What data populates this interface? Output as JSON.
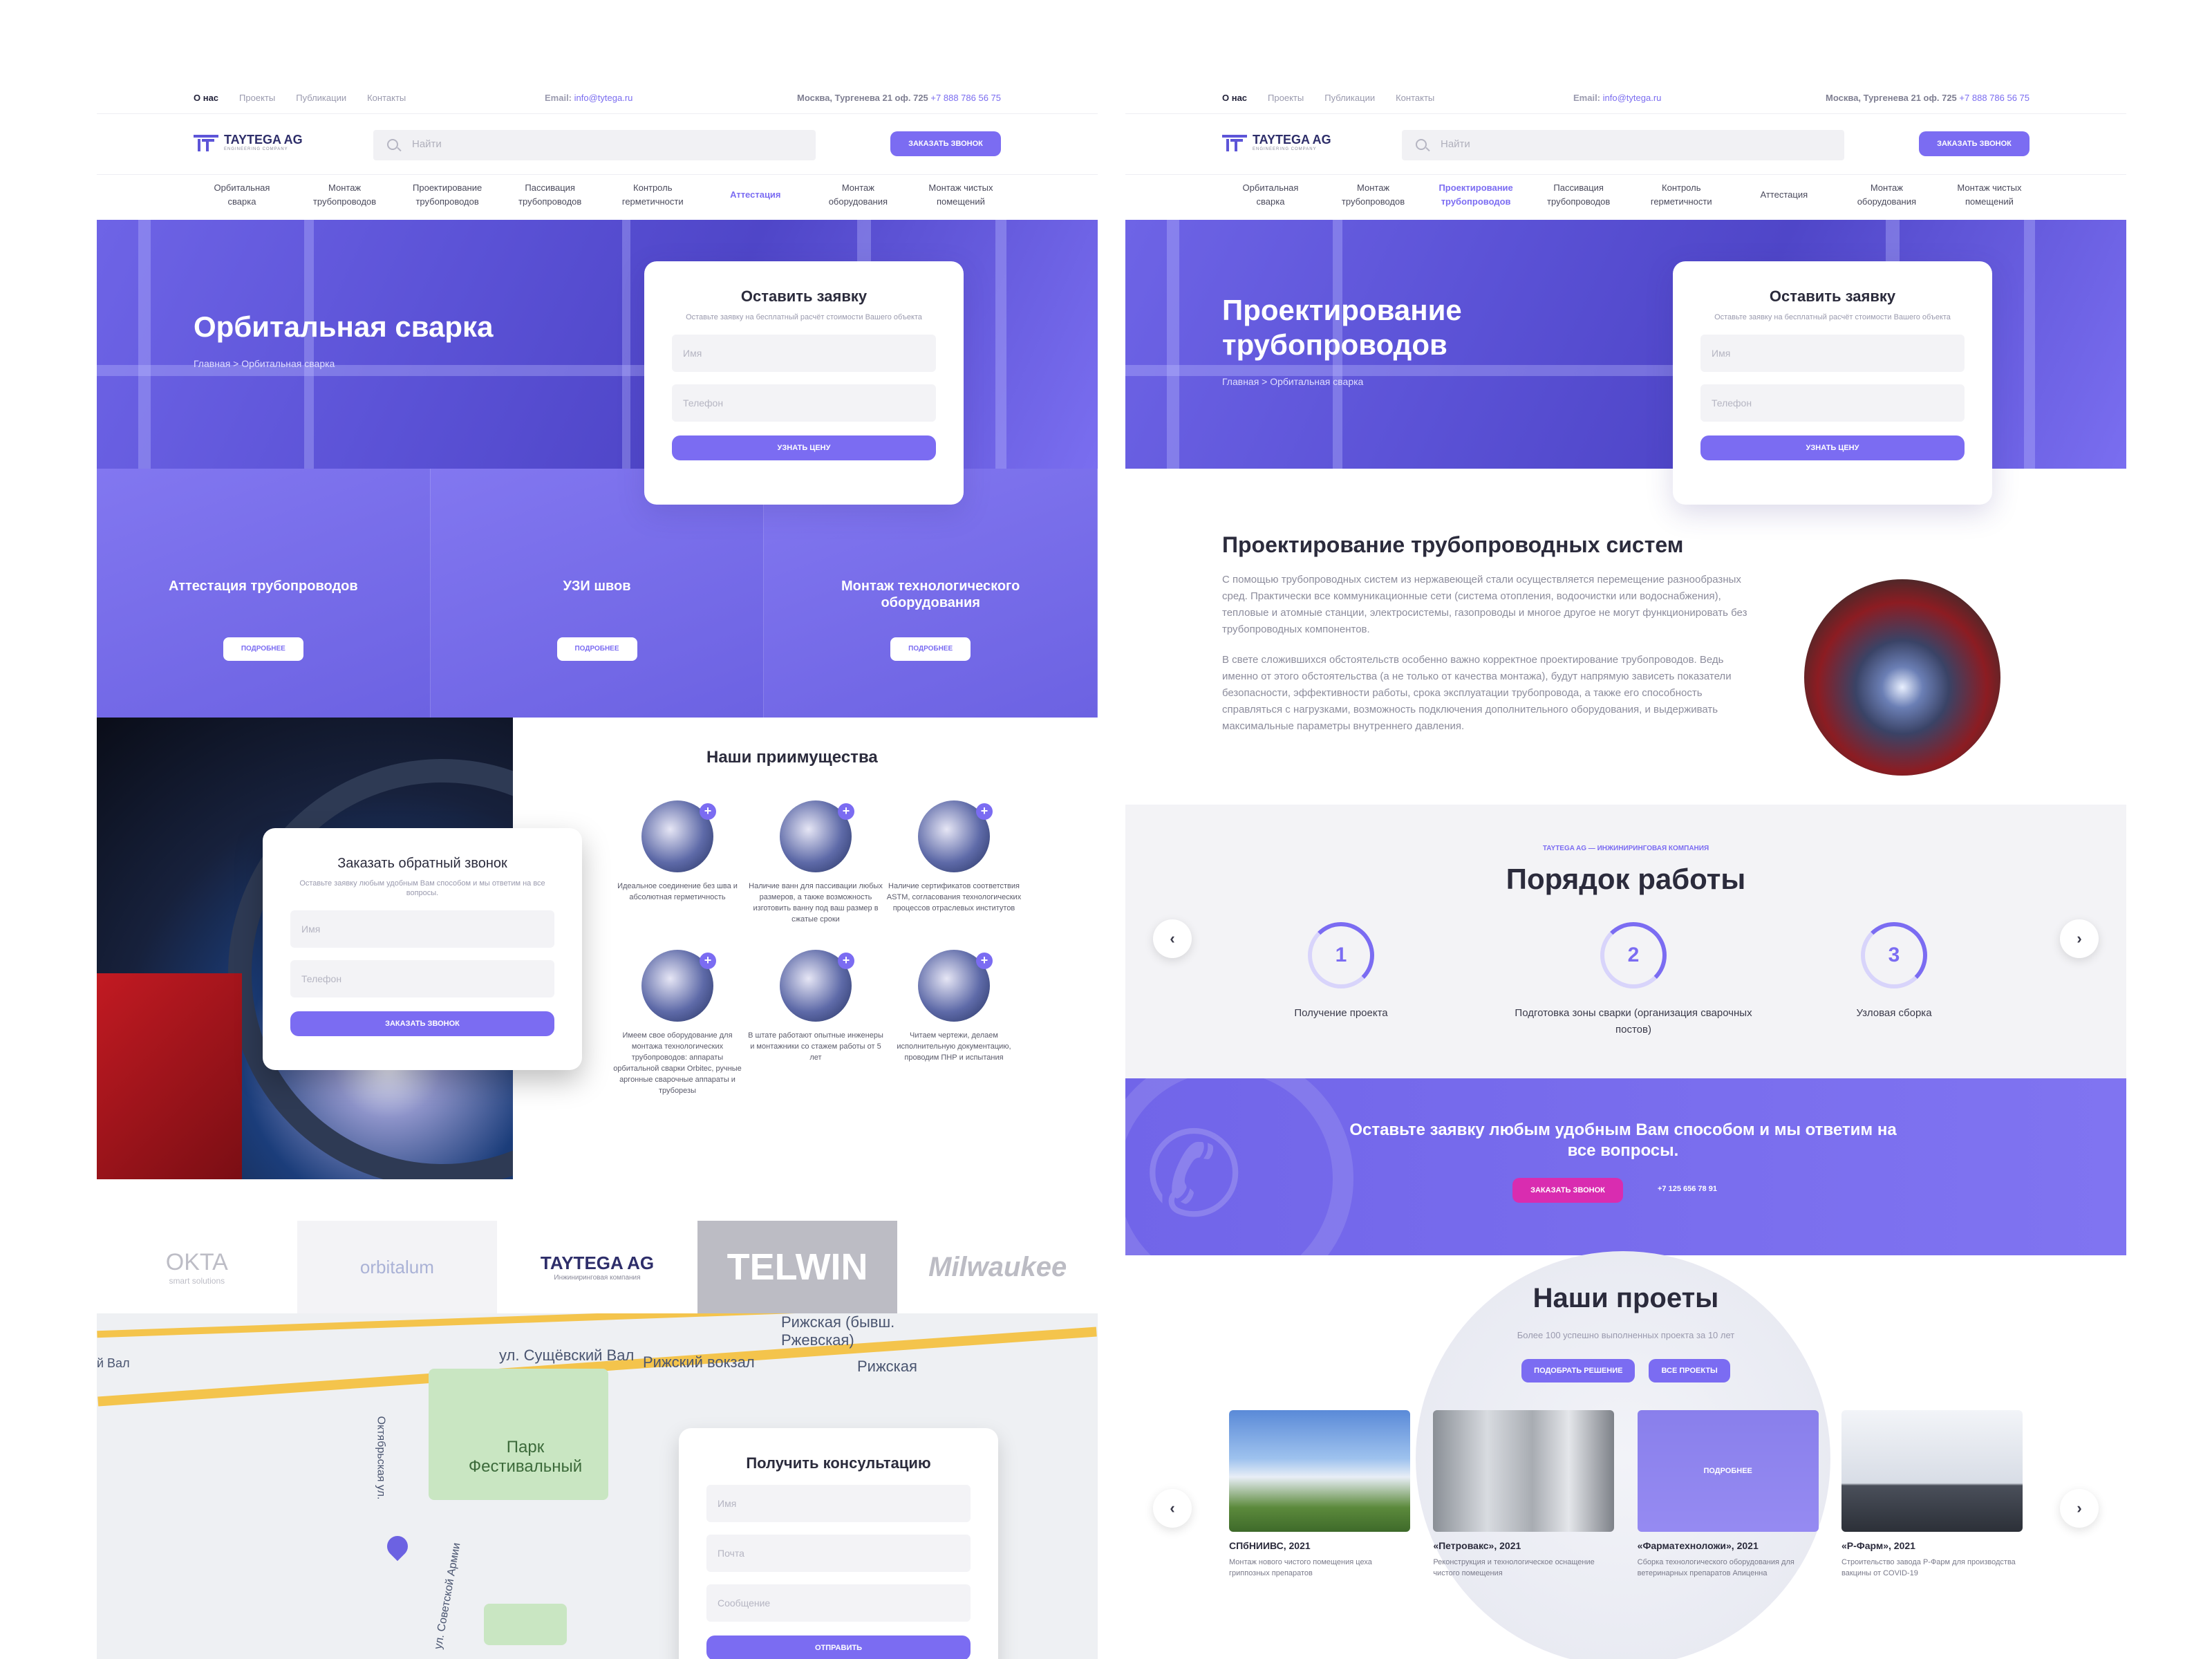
{
  "topnav": {
    "links": [
      "О нас",
      "Проекты",
      "Публикации",
      "Контакты"
    ],
    "email_label": "Email:",
    "email": "info@tytega.ru",
    "address": "Москва, Тургенева 21 оф. 725",
    "phone": "+7 888 786 56 75"
  },
  "header": {
    "logo": "TAYTEGA AG",
    "logo_sub": "ENGINEERING COMPANY",
    "search_placeholder": "Найти",
    "call_button": "ЗАКАЗАТЬ ЗВОНОК"
  },
  "catnav": [
    "Орбитальная сварка",
    "Монтаж трубопроводов",
    "Проектирование трубопроводов",
    "Пассивация трубопроводов",
    "Контроль герметичности",
    "Аттестация",
    "Монтаж оборудования",
    "Монтаж чистых помещений"
  ],
  "left": {
    "hero_title": "Орбитальная сварка",
    "breadcrumb": "Главная > Орбитальная сварка",
    "form": {
      "title": "Оставить заявку",
      "desc": "Оставьте заявку на бесплатный расчёт стоимости Вашего объекта",
      "name": "Имя",
      "phone": "Телефон",
      "button": "УЗНАТЬ ЦЕНУ"
    },
    "tiles": [
      {
        "title": "Аттестация трубопроводов",
        "button": "ПОДРОБНЕЕ"
      },
      {
        "title": "УЗИ швов",
        "button": "ПОДРОБНЕЕ"
      },
      {
        "title": "Монтаж технологического оборудования",
        "button": "ПОДРОБНЕЕ"
      }
    ],
    "callback": {
      "title": "Заказать обратный звонок",
      "desc": "Оставьте заявку любым удобным Вам способом и мы ответим на все вопросы.",
      "name": "Имя",
      "phone": "Телефон",
      "button": "ЗАКАЗАТЬ ЗВОНОК"
    },
    "adv_title": "Наши приимущества",
    "advantages": [
      "Идеальное соединение без шва и абсолютная герметичность",
      "Наличие ванн для пассивации любых размеров, а также возможность изготовить ванну под ваш размер в сжатые сроки",
      "Наличие сертификатов соответствия ASTM, согласования технологических процессов отраслевых институтов",
      "Имеем свое оборудование для монтажа технологических трубопроводов: аппараты орбитальной сварки Orbitec, ручные аргонные сварочные аппараты и труборезы",
      "В штате работают опытные инженеры и монтажники со стажем работы от 5 лет",
      "Читаем чертежи, делаем исполнительную документацию, проводим ПНР и испытания"
    ],
    "partners": [
      "OKTA",
      "smart solutions",
      "orbitalum",
      "TAYTEGA AG",
      "Инжиниринговая компания",
      "TELWIN",
      "Milwaukee"
    ],
    "map_labels": [
      "ул. Сущёвский Вал",
      "Рижский вокзал",
      "Рижская",
      "Рижская (бывш. Ржевская)",
      "Парк Фестивальный",
      "Октябрьская ул.",
      "ул. Советской Армии",
      "й Вал"
    ],
    "consult": {
      "title": "Получить консультацию",
      "name": "Имя",
      "mail": "Почта",
      "message": "Сообщение",
      "button": "ОТПРАВИТЬ"
    }
  },
  "right": {
    "hero_title_1": "Проектирование",
    "hero_title_2": "трубопроводов",
    "breadcrumb": "Главная > Орбитальная сварка",
    "form": {
      "title": "Оставить заявку",
      "desc": "Оставьте заявку на бесплатный расчёт стоимости Вашего объекта",
      "name": "Имя",
      "phone": "Телефон",
      "button": "УЗНАТЬ ЦЕНУ"
    },
    "section_title": "Проектирование трубопроводных систем",
    "para1": "С помощью трубопроводных систем из нержавеющей стали осуществляется перемещение разнообразных сред. Практически все коммуникационные сети (система отопления, водоочистки или водоснабжения), тепловые и атомные станции, электросистемы, газопроводы и многое другое не могут функционировать без трубопроводных компонентов.",
    "para2": "В свете сложившихся обстоятельств особенно важно корректное проектирование трубопроводов. Ведь именно от этого обстоятельства (а не только от качества монтажа), будут напрямую зависеть показатели безопасности, эффективности работы, срока эксплуатации трубопровода, а также его способность справляться с нагрузками, возможность подключения дополнительного оборудования, и выдерживать максимальные параметры внутреннего давления.",
    "order_kicker": "TAYTEGA AG — ИНЖИНИРИНГОВАЯ КОМПАНИЯ",
    "order_title": "Порядок работы",
    "steps": [
      {
        "num": "1",
        "label": "Получение проекта"
      },
      {
        "num": "2",
        "label": "Подготовка зоны сварки (организация сварочных постов)"
      },
      {
        "num": "3",
        "label": "Узловая сборка"
      }
    ],
    "cta_text": "Оставьте заявку любым удобным Вам способом и мы ответим на все вопросы.",
    "cta_button": "ЗАКАЗАТЬ ЗВОНОК",
    "cta_phone": "+7 125 656 78 91",
    "projects_title": "Наши проеты",
    "projects_sub": "Более 100 успешно выполненных проекта за 10 лет",
    "proj_btn1": "ПОДОБРАТЬ РЕШЕНИЕ",
    "proj_btn2": "ВСЕ ПРОЕКТЫ",
    "projects": [
      {
        "title": "СПбНИИВС, 2021",
        "desc": "Монтаж нового чистого помещения цеха гриппозных препаратов"
      },
      {
        "title": "«Петровакс», 2021",
        "desc": "Реконструкция и технологическое оснащение чистого помещения"
      },
      {
        "title": "«Фарматехноложи», 2021",
        "desc": "Сборка технологического оборудования для ветеринарных препаратов Апиценна",
        "overlay": "ПОДРОБНЕЕ"
      },
      {
        "title": "«Р-Фарм», 2021",
        "desc": "Строительство завода Р-Фарм для производства вакцины от COVID-19"
      }
    ]
  },
  "colors": {
    "accent": "#7b6cf2",
    "pink": "#d92cb0"
  }
}
